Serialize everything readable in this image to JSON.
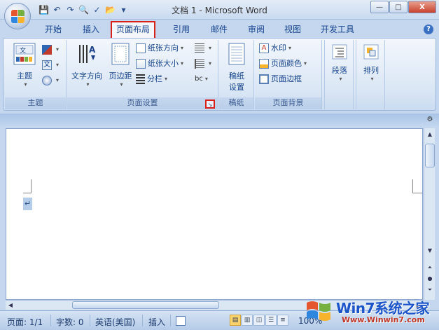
{
  "window": {
    "title": "文档 1 - Microsoft Word",
    "controls": {
      "minimize": "—",
      "restore": "□",
      "close": "X"
    }
  },
  "quick_access": [
    "save-icon",
    "undo-icon",
    "redo-icon",
    "print-preview-icon",
    "spelling-icon",
    "open-folder-icon",
    "customize-icon"
  ],
  "tabs": [
    {
      "label": "开始"
    },
    {
      "label": "插入"
    },
    {
      "label": "页面布局",
      "active": true
    },
    {
      "label": "引用"
    },
    {
      "label": "邮件"
    },
    {
      "label": "审阅"
    },
    {
      "label": "视图"
    },
    {
      "label": "开发工具"
    }
  ],
  "help": "?",
  "ribbon": {
    "theme_group": {
      "label": "主题",
      "theme_button": "主题"
    },
    "page_setup_group": {
      "label": "页面设置",
      "text_direction": "文字方向",
      "margins": "页边距",
      "orientation": "纸张方向",
      "size": "纸张大小",
      "columns": "分栏",
      "breaks_glyph": "bc",
      "launcher_glyph": "↘"
    },
    "draft_group": {
      "label": "稿纸",
      "draft_settings_line1": "稿纸",
      "draft_settings_line2": "设置"
    },
    "background_group": {
      "label": "页面背景",
      "watermark": "水印",
      "page_color": "页面颜色",
      "page_borders": "页面边框"
    },
    "paragraph_group": {
      "label": "段落"
    },
    "arrange_group": {
      "label": "排列"
    }
  },
  "document": {
    "paragraph_mark": "↵"
  },
  "status_bar": {
    "page": "页面: 1/1",
    "words": "字数: 0",
    "language": "英语(美国)",
    "insert_mode": "插入",
    "zoom": "100%"
  },
  "watermark": {
    "text": "Win7系统之家",
    "url": "Www.Winwin7.com"
  },
  "colors": {
    "active_tab_outline": "#d9211a",
    "ribbon_text": "#15428b"
  }
}
